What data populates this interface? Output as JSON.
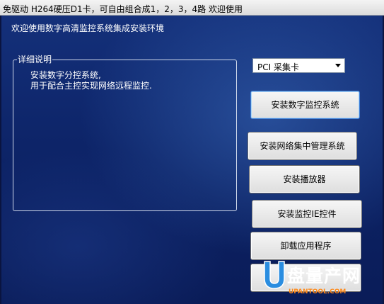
{
  "window": {
    "title": "免驱动 H264硬压D1卡，可自由组合成1，2，3，4路 欢迎使用"
  },
  "main": {
    "welcome_text": "欢迎使用数字高清监控系统集成安装环境",
    "details": {
      "legend": "详细说明",
      "line1": "安装数字分控系统,",
      "line2": "用于配合主控实现网络远程监控."
    },
    "card_select": {
      "value": "PCI 采集卡"
    },
    "buttons": {
      "install_digital": "安装数字监控系统",
      "install_network": "安装网络集中管理系统",
      "install_player": "安装播放器",
      "install_ocx": "安装监控IE控件",
      "uninstall": "卸载应用程序"
    }
  },
  "watermark": {
    "wordmark": "盘量产网",
    "domain": "UPANTOOL.COM"
  }
}
